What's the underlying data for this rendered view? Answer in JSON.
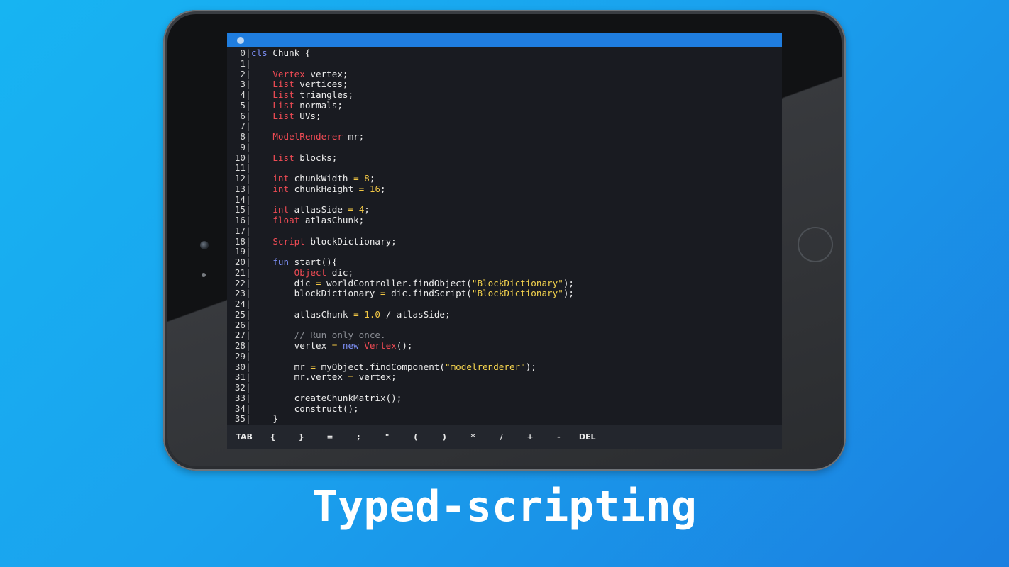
{
  "caption": "Typed-scripting",
  "colors": {
    "background_start": "#17b4f2",
    "background_end": "#1b7fe0",
    "status_bar": "#1f7ddf",
    "editor_bg": "#191b21",
    "keyword": "#7a8cf0",
    "type": "#ef4b54",
    "number_string": "#f2c744",
    "comment": "#8a8d94"
  },
  "editor": {
    "lines": [
      {
        "n": "0",
        "tokens": [
          {
            "t": "cls",
            "c": "kw"
          },
          {
            "t": " Chunk {",
            "c": "id"
          }
        ]
      },
      {
        "n": "1",
        "tokens": []
      },
      {
        "n": "2",
        "tokens": [
          {
            "t": "    ",
            "c": "id"
          },
          {
            "t": "Vertex",
            "c": "type"
          },
          {
            "t": " vertex;",
            "c": "id"
          }
        ]
      },
      {
        "n": "3",
        "tokens": [
          {
            "t": "    ",
            "c": "id"
          },
          {
            "t": "List",
            "c": "type"
          },
          {
            "t": " vertices;",
            "c": "id"
          }
        ]
      },
      {
        "n": "4",
        "tokens": [
          {
            "t": "    ",
            "c": "id"
          },
          {
            "t": "List",
            "c": "type"
          },
          {
            "t": " triangles;",
            "c": "id"
          }
        ]
      },
      {
        "n": "5",
        "tokens": [
          {
            "t": "    ",
            "c": "id"
          },
          {
            "t": "List",
            "c": "type"
          },
          {
            "t": " normals;",
            "c": "id"
          }
        ]
      },
      {
        "n": "6",
        "tokens": [
          {
            "t": "    ",
            "c": "id"
          },
          {
            "t": "List",
            "c": "type"
          },
          {
            "t": " UVs;",
            "c": "id"
          }
        ]
      },
      {
        "n": "7",
        "tokens": []
      },
      {
        "n": "8",
        "tokens": [
          {
            "t": "    ",
            "c": "id"
          },
          {
            "t": "ModelRenderer",
            "c": "type"
          },
          {
            "t": " mr;",
            "c": "id"
          }
        ]
      },
      {
        "n": "9",
        "tokens": []
      },
      {
        "n": "10",
        "tokens": [
          {
            "t": "    ",
            "c": "id"
          },
          {
            "t": "List",
            "c": "type"
          },
          {
            "t": " blocks;",
            "c": "id"
          }
        ]
      },
      {
        "n": "11",
        "tokens": []
      },
      {
        "n": "12",
        "tokens": [
          {
            "t": "    ",
            "c": "id"
          },
          {
            "t": "int",
            "c": "type"
          },
          {
            "t": " chunkWidth ",
            "c": "id"
          },
          {
            "t": "=",
            "c": "op"
          },
          {
            "t": " ",
            "c": "id"
          },
          {
            "t": "8",
            "c": "num"
          },
          {
            "t": ";",
            "c": "id"
          }
        ]
      },
      {
        "n": "13",
        "tokens": [
          {
            "t": "    ",
            "c": "id"
          },
          {
            "t": "int",
            "c": "type"
          },
          {
            "t": " chunkHeight ",
            "c": "id"
          },
          {
            "t": "=",
            "c": "op"
          },
          {
            "t": " ",
            "c": "id"
          },
          {
            "t": "16",
            "c": "num"
          },
          {
            "t": ";",
            "c": "id"
          }
        ]
      },
      {
        "n": "14",
        "tokens": []
      },
      {
        "n": "15",
        "tokens": [
          {
            "t": "    ",
            "c": "id"
          },
          {
            "t": "int",
            "c": "type"
          },
          {
            "t": " atlasSide ",
            "c": "id"
          },
          {
            "t": "=",
            "c": "op"
          },
          {
            "t": " ",
            "c": "id"
          },
          {
            "t": "4",
            "c": "num"
          },
          {
            "t": ";",
            "c": "id"
          }
        ]
      },
      {
        "n": "16",
        "tokens": [
          {
            "t": "    ",
            "c": "id"
          },
          {
            "t": "float",
            "c": "type"
          },
          {
            "t": " atlasChunk;",
            "c": "id"
          }
        ]
      },
      {
        "n": "17",
        "tokens": []
      },
      {
        "n": "18",
        "tokens": [
          {
            "t": "    ",
            "c": "id"
          },
          {
            "t": "Script",
            "c": "type"
          },
          {
            "t": " blockDictionary;",
            "c": "id"
          }
        ]
      },
      {
        "n": "19",
        "tokens": []
      },
      {
        "n": "20",
        "tokens": [
          {
            "t": "    ",
            "c": "id"
          },
          {
            "t": "fun",
            "c": "kw"
          },
          {
            "t": " start(){",
            "c": "id"
          }
        ]
      },
      {
        "n": "21",
        "tokens": [
          {
            "t": "        ",
            "c": "id"
          },
          {
            "t": "Object",
            "c": "type"
          },
          {
            "t": " dic;",
            "c": "id"
          }
        ]
      },
      {
        "n": "22",
        "tokens": [
          {
            "t": "        dic ",
            "c": "id"
          },
          {
            "t": "=",
            "c": "op"
          },
          {
            "t": " worldController.findObject(",
            "c": "id"
          },
          {
            "t": "\"BlockDictionary\"",
            "c": "str"
          },
          {
            "t": ");",
            "c": "id"
          }
        ]
      },
      {
        "n": "23",
        "tokens": [
          {
            "t": "        blockDictionary ",
            "c": "id"
          },
          {
            "t": "=",
            "c": "op"
          },
          {
            "t": " dic.findScript(",
            "c": "id"
          },
          {
            "t": "\"BlockDictionary\"",
            "c": "str"
          },
          {
            "t": ");",
            "c": "id"
          }
        ]
      },
      {
        "n": "24",
        "tokens": []
      },
      {
        "n": "25",
        "tokens": [
          {
            "t": "        atlasChunk ",
            "c": "id"
          },
          {
            "t": "=",
            "c": "op"
          },
          {
            "t": " ",
            "c": "id"
          },
          {
            "t": "1.0",
            "c": "num"
          },
          {
            "t": " / atlasSide;",
            "c": "id"
          }
        ]
      },
      {
        "n": "26",
        "tokens": []
      },
      {
        "n": "27",
        "tokens": [
          {
            "t": "        ",
            "c": "id"
          },
          {
            "t": "// Run only once.",
            "c": "cmt"
          }
        ]
      },
      {
        "n": "28",
        "tokens": [
          {
            "t": "        vertex ",
            "c": "id"
          },
          {
            "t": "=",
            "c": "op"
          },
          {
            "t": " ",
            "c": "id"
          },
          {
            "t": "new",
            "c": "kw"
          },
          {
            "t": " ",
            "c": "id"
          },
          {
            "t": "Vertex",
            "c": "type"
          },
          {
            "t": "();",
            "c": "id"
          }
        ]
      },
      {
        "n": "29",
        "tokens": []
      },
      {
        "n": "30",
        "tokens": [
          {
            "t": "        mr ",
            "c": "id"
          },
          {
            "t": "=",
            "c": "op"
          },
          {
            "t": " myObject.findComponent(",
            "c": "id"
          },
          {
            "t": "\"modelrenderer\"",
            "c": "str"
          },
          {
            "t": ");",
            "c": "id"
          }
        ]
      },
      {
        "n": "31",
        "tokens": [
          {
            "t": "        mr.vertex ",
            "c": "id"
          },
          {
            "t": "=",
            "c": "op"
          },
          {
            "t": " vertex;",
            "c": "id"
          }
        ]
      },
      {
        "n": "32",
        "tokens": []
      },
      {
        "n": "33",
        "tokens": [
          {
            "t": "        createChunkMatrix();",
            "c": "id"
          }
        ]
      },
      {
        "n": "34",
        "tokens": [
          {
            "t": "        construct();",
            "c": "id"
          }
        ]
      },
      {
        "n": "35",
        "tokens": [
          {
            "t": "    }",
            "c": "id"
          }
        ]
      }
    ]
  },
  "keybar": {
    "keys": [
      "TAB",
      "{",
      "}",
      "=",
      ";",
      "\"",
      "(",
      ")",
      "*",
      "/",
      "+",
      "-",
      "DEL"
    ]
  }
}
